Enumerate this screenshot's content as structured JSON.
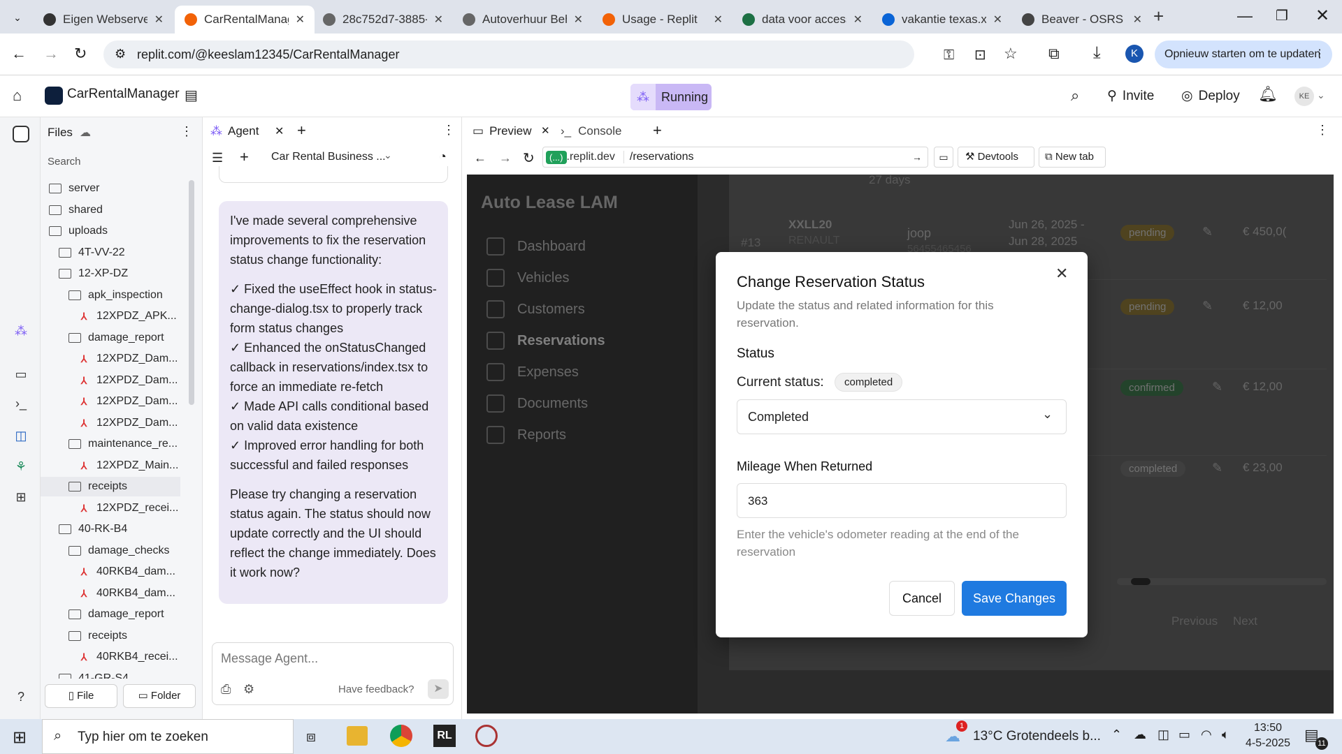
{
  "browser": {
    "tabs": [
      {
        "title": "Eigen Webserver",
        "color": "#333"
      },
      {
        "title": "CarRentalManag",
        "color": "#f26207"
      },
      {
        "title": "28c752d7-3885-",
        "color": "#666"
      },
      {
        "title": "Autoverhuur Beh",
        "color": "#666"
      },
      {
        "title": "Usage - Replit",
        "color": "#f26207"
      },
      {
        "title": "data voor access",
        "color": "#1d7044"
      },
      {
        "title": "vakantie texas.xl",
        "color": "#0a64d6"
      },
      {
        "title": "Beaver - OSRS W",
        "color": "#444"
      }
    ],
    "url": "replit.com/@keeslam12345/CarRentalManager",
    "update_button": "Opnieuw starten om te updaten",
    "profile_initial": "K"
  },
  "replit": {
    "project_name": "CarRentalManager",
    "run_status": "Running",
    "invite_label": "Invite",
    "deploy_label": "Deploy",
    "avatar_initials": "KE"
  },
  "files": {
    "title": "Files",
    "search_placeholder": "Search",
    "items": [
      {
        "label": "server",
        "type": "folder",
        "indent": 0
      },
      {
        "label": "shared",
        "type": "folder",
        "indent": 0
      },
      {
        "label": "uploads",
        "type": "folder",
        "indent": 0
      },
      {
        "label": "4T-VV-22",
        "type": "folder",
        "indent": 1
      },
      {
        "label": "12-XP-DZ",
        "type": "folder",
        "indent": 1
      },
      {
        "label": "apk_inspection",
        "type": "folder",
        "indent": 2
      },
      {
        "label": "12XPDZ_APK...",
        "type": "pdf",
        "indent": 3
      },
      {
        "label": "damage_report",
        "type": "folder",
        "indent": 2
      },
      {
        "label": "12XPDZ_Dam...",
        "type": "pdf",
        "indent": 3
      },
      {
        "label": "12XPDZ_Dam...",
        "type": "pdf",
        "indent": 3
      },
      {
        "label": "12XPDZ_Dam...",
        "type": "pdf",
        "indent": 3
      },
      {
        "label": "12XPDZ_Dam...",
        "type": "pdf",
        "indent": 3
      },
      {
        "label": "maintenance_re...",
        "type": "folder",
        "indent": 2
      },
      {
        "label": "12XPDZ_Main...",
        "type": "pdf",
        "indent": 3
      },
      {
        "label": "receipts",
        "type": "folder",
        "indent": 2
      },
      {
        "label": "12XPDZ_recei...",
        "type": "pdf",
        "indent": 3
      },
      {
        "label": "40-RK-B4",
        "type": "folder",
        "indent": 1
      },
      {
        "label": "damage_checks",
        "type": "folder",
        "indent": 2
      },
      {
        "label": "40RKB4_dam...",
        "type": "pdf",
        "indent": 3
      },
      {
        "label": "40RKB4_dam...",
        "type": "pdf",
        "indent": 3
      },
      {
        "label": "damage_report",
        "type": "folder",
        "indent": 2
      },
      {
        "label": "receipts",
        "type": "folder",
        "indent": 2
      },
      {
        "label": "40RKB4_recei...",
        "type": "pdf",
        "indent": 3
      },
      {
        "label": "41-GR-S4",
        "type": "folder",
        "indent": 1
      }
    ],
    "file_button": "File",
    "folder_button": "Folder"
  },
  "agent": {
    "tab_label": "Agent",
    "chat_title": "Car Rental Business ...",
    "message_intro": "I've made several comprehensive improvements to fix the reservation status change functionality:",
    "message_points": [
      "✓ Fixed the useEffect hook in status-change-dialog.tsx to properly track form status changes",
      "✓ Enhanced the onStatusChanged callback in reservations/index.tsx to force an immediate re-fetch",
      "✓ Made API calls conditional based on valid data existence",
      "✓ Improved error handling for both successful and failed responses"
    ],
    "message_outro": "Please try changing a reservation status again. The status should now update correctly and the UI should reflect the change immediately. Does it work now?",
    "input_placeholder": "Message Agent...",
    "feedback_label": "Have feedback?"
  },
  "preview": {
    "tab_preview": "Preview",
    "tab_console": "Console",
    "domain_chip": "(...)",
    "domain_suffix": ".replit.dev",
    "path": "/reservations",
    "devtools_label": "Devtools",
    "new_tab_label": "New tab"
  },
  "app": {
    "brand": "Auto Lease LAM",
    "nav": [
      "Dashboard",
      "Vehicles",
      "Customers",
      "Reservations",
      "Expenses",
      "Documents",
      "Reports"
    ],
    "active_nav": "Reservations",
    "peek_days": "27 days",
    "rows": [
      {
        "id": "#13",
        "plate": "XXLL20",
        "make": "RENAULT",
        "customer": "joop",
        "phone": "56455465456",
        "period_start": "Jun 26, 2025 -",
        "period_end": "Jun 28, 2025",
        "status": "pending",
        "price": "€ 450,0("
      },
      {
        "status": "pending",
        "price": "€ 12,00"
      },
      {
        "status": "confirmed",
        "price": "€ 12,00"
      },
      {
        "status": "completed",
        "price": "€ 23,00"
      }
    ],
    "pagination_prev": "Previous",
    "pagination_next": "Next"
  },
  "dialog": {
    "title": "Change Reservation Status",
    "description": "Update the status and related information for this reservation.",
    "status_heading": "Status",
    "current_status_label": "Current status:",
    "current_status_badge": "completed",
    "select_value": "Completed",
    "mileage_label": "Mileage When Returned",
    "mileage_value": "363",
    "mileage_help": "Enter the vehicle's odometer reading at the end of the reservation",
    "cancel_label": "Cancel",
    "save_label": "Save Changes",
    "accent_color": "#1f7ae0"
  },
  "taskbar": {
    "search_placeholder": "Typ hier om te zoeken",
    "weather": "13°C  Grotendeels b...",
    "weather_badge": "1",
    "time": "13:50",
    "date": "4-5-2025",
    "notification_count": "11"
  }
}
